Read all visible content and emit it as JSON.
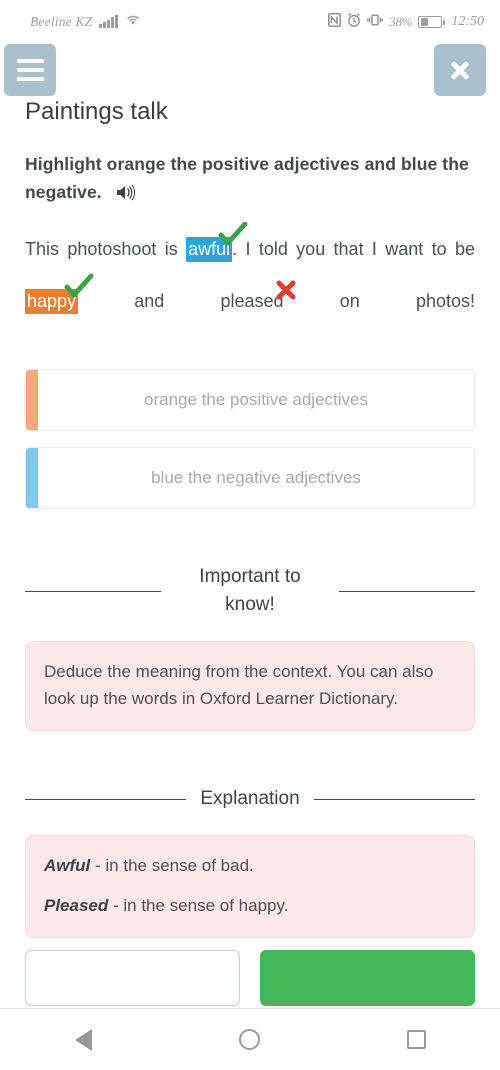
{
  "statusbar": {
    "carrier": "Beeline KZ",
    "battery_percent": "38%",
    "time": "12:50",
    "icons": [
      "signal-icon",
      "wifi-icon",
      "nfc-icon",
      "alarm-icon",
      "vibrate-icon",
      "battery-icon"
    ]
  },
  "header": {
    "menu_icon": "hamburger-menu-icon",
    "close_icon": "close-icon",
    "title": "Paintings talk",
    "button_color": "#a9c0cd"
  },
  "task": {
    "instruction": "Highlight orange the positive adjectives and blue the negative.",
    "audio_icon": "speaker-icon",
    "sentence": {
      "part1": "This  photoshoot  is ",
      "word_awful": "awful",
      "part2": ".  I  told  you  that  I  want  to  be ",
      "word_happy": "happy",
      "part3": "  and  pleased",
      "part4": "  on  photos!",
      "awful_highlight_color": "#2fa3dd",
      "happy_highlight_color": "#e87f33",
      "awful_mark": "check-mark-icon",
      "happy_mark": "check-mark-icon",
      "pleased_mark": "cross-mark-icon"
    }
  },
  "answers": [
    {
      "placeholder": "orange the positive adjectives",
      "value": "",
      "bar_color": "#f4a97c",
      "bar_class": "orange"
    },
    {
      "placeholder": "blue the negative adjectives",
      "value": "",
      "bar_color": "#7fc8ef",
      "bar_class": "blue"
    }
  ],
  "important": {
    "heading": "Important to know!",
    "body": "Deduce the meaning from the context. You can also look up the words in Oxford Learner Dictionary."
  },
  "explanation": {
    "heading": "Explanation",
    "lines": [
      {
        "term": "Awful",
        "rest": " - in the sense of bad."
      },
      {
        "term": "Pleased",
        "rest": " - in the sense of happy."
      }
    ]
  },
  "bottom_buttons": {
    "secondary_label": "",
    "primary_label": "",
    "primary_color": "#47b55a"
  },
  "navbar": {
    "back": "back-triangle-icon",
    "home": "home-circle-icon",
    "recents": "recents-square-icon"
  }
}
